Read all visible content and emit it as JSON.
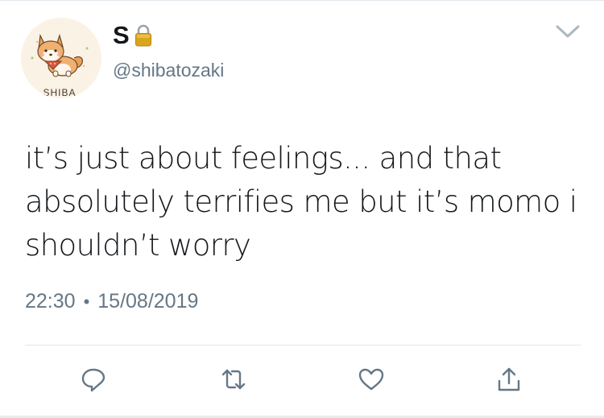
{
  "user": {
    "display_name": "S",
    "handle": "@shibatozaki",
    "avatar_text": "SHIBA",
    "lock_icon": "lock-icon"
  },
  "tweet": {
    "line1": "it’s just about feelings... and that",
    "line2": "absolutely terrifies me but it’s momo i",
    "line3": "shouldn’t worry",
    "time": "22:30",
    "separator": "•",
    "date": "15/08/2019"
  },
  "actions": {
    "icons": [
      "reply-icon",
      "retweet-icon",
      "like-icon",
      "share-icon"
    ]
  },
  "colors": {
    "text": "#14171a",
    "secondary": "#657786",
    "icon": "#657786",
    "divider": "#e1e8ed",
    "avatar_bg": "#fbf2e6",
    "lock_gold": "#d9a520"
  }
}
